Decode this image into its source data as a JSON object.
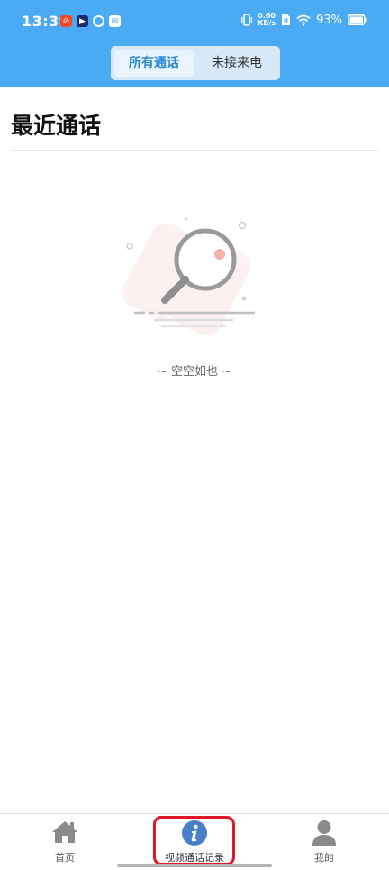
{
  "status_bar": {
    "time": "13:39",
    "net_speed_value": "0.60",
    "net_speed_unit": "KB/s",
    "battery": "93%",
    "notification_icons": [
      "red-app-icon",
      "video-app-icon",
      "ring-app-icon",
      "mail-icon"
    ]
  },
  "tabs": [
    {
      "label": "所有通话",
      "active": true
    },
    {
      "label": "未接来电",
      "active": false
    }
  ],
  "page_title": "最近通话",
  "empty_state": {
    "text": "~ 空空如也 ~",
    "icon": "magnifier-icon"
  },
  "bottom_nav": [
    {
      "label": "首页",
      "icon": "home-icon",
      "active": false
    },
    {
      "label": "视频通话记录",
      "icon": "info-icon",
      "active": true
    },
    {
      "label": "我的",
      "icon": "user-icon",
      "active": false
    }
  ],
  "colors": {
    "header": "#4aaaf3",
    "active_tab_text": "#2a89d8",
    "nav_active": "#4a7fc8",
    "highlight": "#e0182a"
  }
}
